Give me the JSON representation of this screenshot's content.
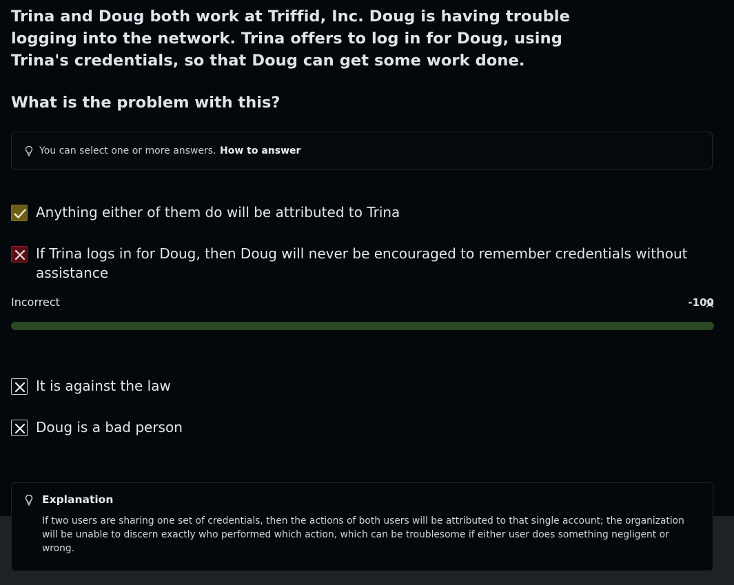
{
  "question": {
    "prompt": "Trina and Doug both work at Triffid, Inc. Doug is having trouble logging into the network. Trina offers to log in for Doug, using Trina's credentials, so that Doug can get some work done.",
    "ask": "What is the problem with this?"
  },
  "hint": {
    "icon": "lightbulb-icon",
    "text": "You can select one or more answers.",
    "link": "How to answer"
  },
  "options": [
    {
      "label": "Anything either of them do will be attributed to Trina",
      "state": "correct-selected",
      "icon": "checkmark-icon"
    },
    {
      "label": "If Trina logs in for Doug, then Doug will never be encouraged to remember credentials without assistance",
      "state": "incorrect-selected",
      "icon": "x-icon"
    },
    {
      "label": "It is against the law",
      "state": "not-selected",
      "icon": "x-icon"
    },
    {
      "label": "Doug is a bad person",
      "state": "not-selected",
      "icon": "x-icon"
    }
  ],
  "result": {
    "label": "Incorrect",
    "score": "-100",
    "progress_percent": 100
  },
  "explanation": {
    "icon": "lightbulb-icon",
    "title": "Explanation",
    "text": "If two users are sharing one set of credentials, then the actions of both users will be attributed to that single account; the organization will be unable to discern exactly who performed which action, which can be troublesome if either user does something negligent or wrong."
  },
  "colors": {
    "background": "#04080d",
    "correct": "#6e5d14",
    "incorrect": "#5a0f16",
    "progress": "#2b4a24"
  }
}
